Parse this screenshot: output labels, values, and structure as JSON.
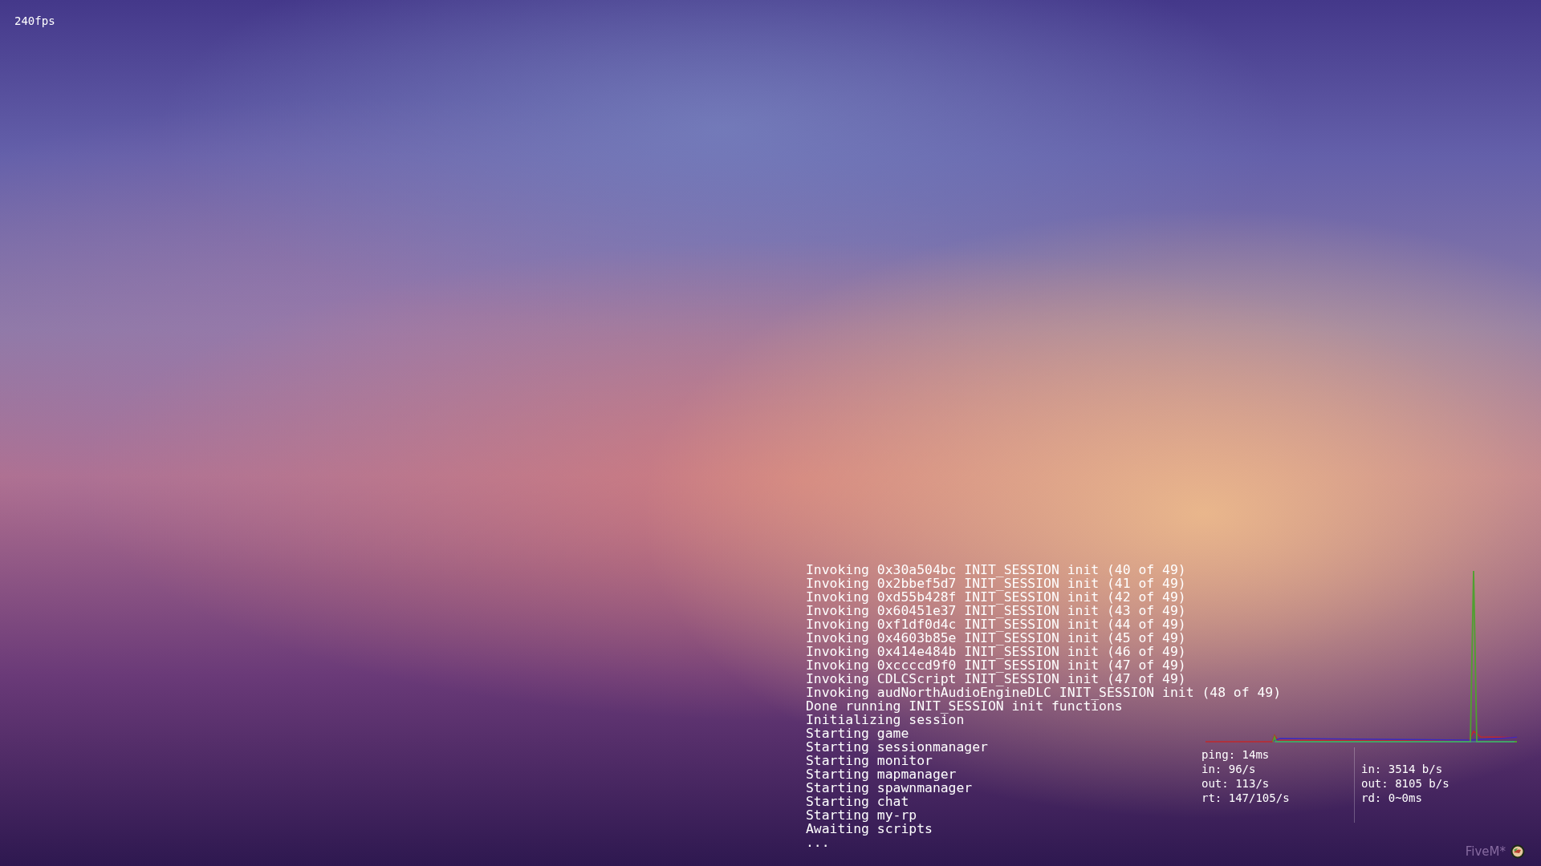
{
  "fps_counter": "240fps",
  "console_log": [
    "Invoking 0x30a504bc INIT_SESSION init (40 of 49)",
    "Invoking 0x2bbef5d7 INIT_SESSION init (41 of 49)",
    "Invoking 0xd55b428f INIT_SESSION init (42 of 49)",
    "Invoking 0x60451e37 INIT_SESSION init (43 of 49)",
    "Invoking 0xf1df0d4c INIT_SESSION init (44 of 49)",
    "Invoking 0x4603b85e INIT_SESSION init (45 of 49)",
    "Invoking 0x414e484b INIT_SESSION init (46 of 49)",
    "Invoking 0xccccd9f0 INIT_SESSION init (47 of 49)",
    "Invoking CDLCScript INIT_SESSION init (47 of 49)",
    "Invoking audNorthAudioEngineDLC INIT_SESSION init (48 of 49)",
    "Done running INIT_SESSION init functions",
    "Initializing session",
    "Starting game",
    "Starting sessionmanager",
    "Starting monitor",
    "Starting mapmanager",
    "Starting spawnmanager",
    "Starting chat",
    "Starting my-rp",
    "Awaiting scripts",
    "..."
  ],
  "net_stats": {
    "left": [
      "ping: 14ms",
      "in: 96/s",
      "out: 113/s",
      "rt: 147/105/s"
    ],
    "right": [
      "in: 3514 b/s",
      "out: 8105 b/s",
      "rd: 0~0ms"
    ]
  },
  "brand": "FiveM*"
}
